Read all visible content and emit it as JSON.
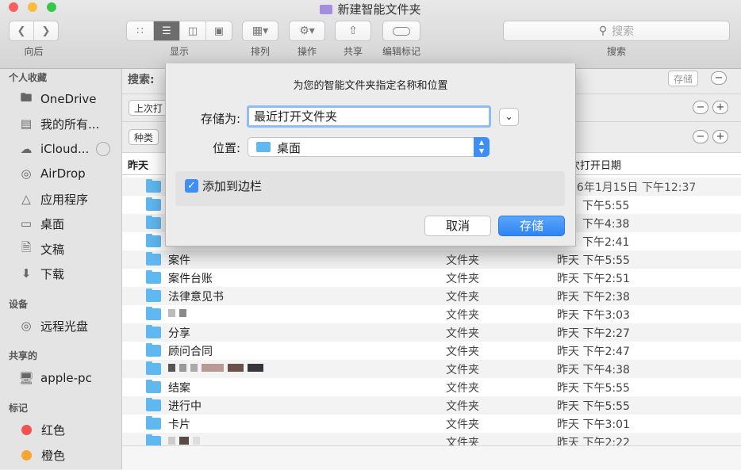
{
  "window": {
    "title": "新建智能文件夹"
  },
  "toolbar": {
    "back_label": "向后",
    "view_label": "显示",
    "arrange_label": "排列",
    "action_label": "操作",
    "share_label": "共享",
    "tags_label": "编辑标记",
    "search_placeholder": "搜索",
    "search_label": "搜索"
  },
  "sidebar": {
    "favorites_header": "个人收藏",
    "favorites": [
      {
        "label": "OneDrive",
        "icon": "folder-icon"
      },
      {
        "label": "我的所有...",
        "icon": "all-files-icon"
      },
      {
        "label": "iCloud...",
        "icon": "cloud-icon"
      },
      {
        "label": "AirDrop",
        "icon": "airdrop-icon"
      },
      {
        "label": "应用程序",
        "icon": "applications-icon"
      },
      {
        "label": "桌面",
        "icon": "desktop-icon"
      },
      {
        "label": "文稿",
        "icon": "documents-icon"
      },
      {
        "label": "下载",
        "icon": "download-icon"
      }
    ],
    "devices_header": "设备",
    "devices": [
      {
        "label": "远程光盘",
        "icon": "disc-icon"
      }
    ],
    "shared_header": "共享的",
    "shared": [
      {
        "label": "apple-pc",
        "icon": "computer-icon"
      }
    ],
    "tags_header": "标记",
    "tags": [
      {
        "label": "红色",
        "color": "#f0524f"
      },
      {
        "label": "橙色",
        "color": "#f7a532"
      }
    ]
  },
  "search_bar": {
    "label": "搜索:",
    "save_label": "存储"
  },
  "criteria": [
    {
      "label": "上次打"
    },
    {
      "label": "种类"
    }
  ],
  "table": {
    "col_name": "昨天",
    "col_date": "次打开日期",
    "rows": [
      {
        "name": "",
        "kind": "",
        "date": "16年1月15日 下午12:37"
      },
      {
        "name": "",
        "kind": "",
        "date": "下午5:55"
      },
      {
        "name": "",
        "kind": "",
        "date": "下午4:38"
      },
      {
        "name": "",
        "kind": "",
        "date": "下午2:41"
      },
      {
        "name": "案件",
        "kind": "文件夹",
        "date": "昨天 下午5:55"
      },
      {
        "name": "案件台账",
        "kind": "文件夹",
        "date": "昨天 下午2:51"
      },
      {
        "name": "法律意见书",
        "kind": "文件夹",
        "date": "昨天 下午2:38"
      },
      {
        "name": "",
        "kind": "文件夹",
        "date": "昨天 下午3:03"
      },
      {
        "name": "分享",
        "kind": "文件夹",
        "date": "昨天 下午2:27"
      },
      {
        "name": "顾问合同",
        "kind": "文件夹",
        "date": "昨天 下午2:47"
      },
      {
        "name": "",
        "kind": "文件夹",
        "date": "昨天 下午4:38"
      },
      {
        "name": "结案",
        "kind": "文件夹",
        "date": "昨天 下午5:55"
      },
      {
        "name": "进行中",
        "kind": "文件夹",
        "date": "昨天 下午5:55"
      },
      {
        "name": "卡片",
        "kind": "文件夹",
        "date": "昨天 下午3:01"
      },
      {
        "name": "",
        "kind": "文件夹",
        "date": "昨天 下午2:22"
      }
    ]
  },
  "dialog": {
    "title": "为您的智能文件夹指定名称和位置",
    "save_as_label": "存储为:",
    "save_as_value": "最近打开文件夹",
    "location_label": "位置:",
    "location_value": "桌面",
    "add_sidebar_label": "添加到边栏",
    "add_sidebar_checked": true,
    "cancel_label": "取消",
    "save_label": "存储"
  }
}
